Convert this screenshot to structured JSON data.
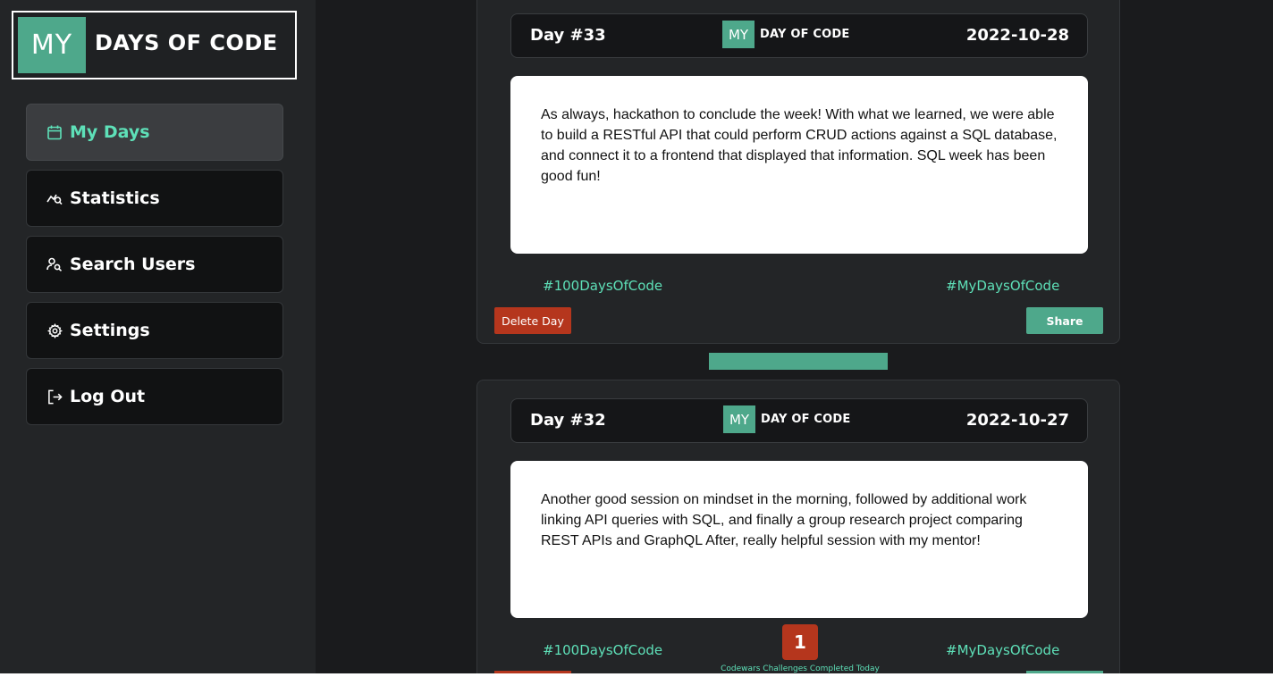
{
  "app": {
    "logo_my": "MY",
    "logo_text": "DAYS OF CODE"
  },
  "sidebar": {
    "items": [
      {
        "label": "My Days",
        "icon": "calendar-icon",
        "active": true
      },
      {
        "label": "Statistics",
        "icon": "chart-search-icon",
        "active": false
      },
      {
        "label": "Search Users",
        "icon": "user-search-icon",
        "active": false
      },
      {
        "label": "Settings",
        "icon": "gear-icon",
        "active": false
      },
      {
        "label": "Log Out",
        "icon": "logout-icon",
        "active": false
      }
    ]
  },
  "days": [
    {
      "day": "Day #33",
      "logo_my": "MY",
      "logo_text": "DAY OF CODE",
      "date": "2022-10-28",
      "text": "As always, hackathon to conclude the week! With what we learned, we were able to build a RESTful API that could perform CRUD actions against a SQL database, and connect it to a frontend that displayed that information. SQL week has been good fun!",
      "tag_left": "#100DaysOfCode",
      "tag_right": "#MyDaysOfCode",
      "delete_label": "Delete Day",
      "share_label": "Share"
    },
    {
      "day": "Day #32",
      "logo_my": "MY",
      "logo_text": "DAY OF CODE",
      "date": "2022-10-27",
      "text": "Another good session on mindset in the morning, followed by additional work linking API queries with SQL, and finally a group research project comparing REST APIs and GraphQL After, really helpful session with my mentor!",
      "tag_left": "#100DaysOfCode",
      "tag_right": "#MyDaysOfCode",
      "codewars_count": "1",
      "codewars_label": "Codewars Challenges Completed Today"
    }
  ],
  "colors": {
    "accent": "#4ea88b",
    "accent_text": "#5ee0b8",
    "danger": "#b5361d",
    "background": "#1a1b1d",
    "sidebar": "#232527"
  }
}
